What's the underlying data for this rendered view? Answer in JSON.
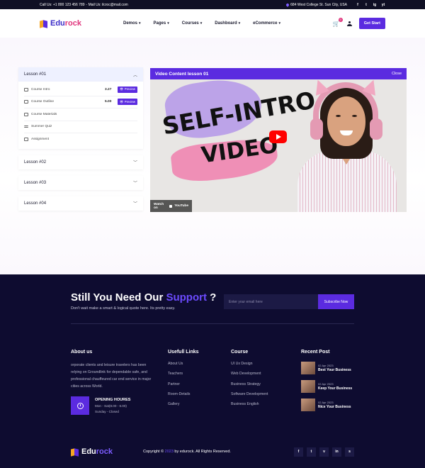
{
  "topbar": {
    "call": "Call Us: +1 800 123 456 789",
    "mail": " - Mail Us: ilcroc@mail.com",
    "address": "684 West College St. Sun City, USA",
    "socials": [
      "f",
      "t",
      "ig",
      "yt"
    ]
  },
  "header": {
    "logo_a": "Edu",
    "logo_b": "rock",
    "nav": [
      "Demos",
      "Pages",
      "Courses",
      "Dashboard",
      "eCommerce"
    ],
    "cart_count": "0",
    "cta": "Get Start"
  },
  "lessons": {
    "l1": "Lesson #01",
    "items": [
      {
        "label": "Course Intro",
        "duration": "3.27",
        "action": "Preview"
      },
      {
        "label": "Course Outline",
        "duration": "5.00",
        "action": "Preview"
      },
      {
        "label": "Course Materials"
      },
      {
        "label": "Summer Quiz"
      },
      {
        "label": "Assignment"
      }
    ],
    "l2": "Lesson #02",
    "l3": "Lesson #03",
    "l4": "Lesson #04"
  },
  "video": {
    "header": "Video Content lesson 01",
    "close": "Close",
    "line1": "SELF-INTRO",
    "line2": "VIDEO",
    "watch_on": "Watch on",
    "watch_brand": "YouTube"
  },
  "subscribe": {
    "title_a": "Still You Need Our ",
    "title_hl": "Support",
    "title_b": " ?",
    "desc": "Don't wait make a smart & logical quote here. Its pretty easy.",
    "placeholder": "Enter your email here",
    "button": "Subscribe Now"
  },
  "footer": {
    "about_title": "About us",
    "about_text": "orporate clients and leisure travelers has been relying on Groundlink for dependable safe, and professional chauffeured car end service in major cities across World.",
    "hours_title": "OPENING HOURES",
    "hours_1": "Mon - Sat(8.00 - 6.00)",
    "hours_2": "Sunday - Closed",
    "links_title": "Usefull Links",
    "links": [
      "About Us",
      "Teachers",
      "Partner",
      "Room-Details",
      "Gallery"
    ],
    "course_title": "Course",
    "courses": [
      "UI Ux Design",
      "Web Development",
      "Business Strategy",
      "Software Development",
      "Business English"
    ],
    "recent_title": "Recent Post",
    "posts": [
      {
        "date": "02 Apr 2023",
        "title": "Best Your Business"
      },
      {
        "date": "02 Apr 2023",
        "title": "Keep Your Business"
      },
      {
        "date": "02 Apr 2023",
        "title": "Nice Your Business"
      }
    ],
    "copy_a": "Copyright © ",
    "copy_year": "2023",
    "copy_b": " by edurock. All Rights Reserved.",
    "socials": [
      "f",
      "t",
      "v",
      "in",
      "s"
    ]
  },
  "colors": {
    "accent": "#5b2be0",
    "footer_bg": "#0e0c30",
    "brand_pink": "#e0357c"
  }
}
